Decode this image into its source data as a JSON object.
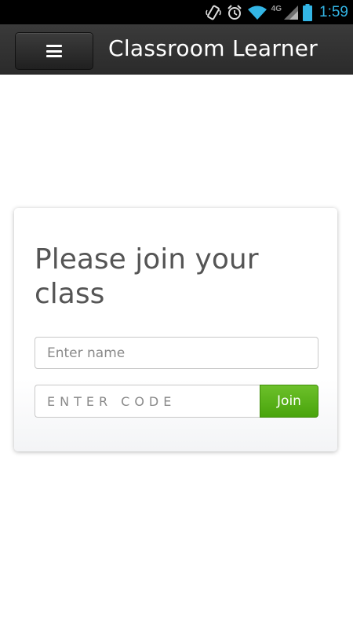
{
  "status_bar": {
    "time": "1:59",
    "network_label": "4G",
    "icons": [
      "vibrate-icon",
      "alarm-icon",
      "wifi-icon",
      "signal-icon",
      "battery-icon"
    ],
    "time_color": "#33b5e5"
  },
  "action_bar": {
    "menu_icon": "hamburger-menu-icon",
    "title": "Classroom Learner"
  },
  "join_card": {
    "heading": "Please join your class",
    "name_placeholder": "Enter name",
    "name_value": "",
    "code_placeholder": "ENTER CODE",
    "code_value": "",
    "join_label": "Join",
    "join_color": "#5cb31a"
  }
}
